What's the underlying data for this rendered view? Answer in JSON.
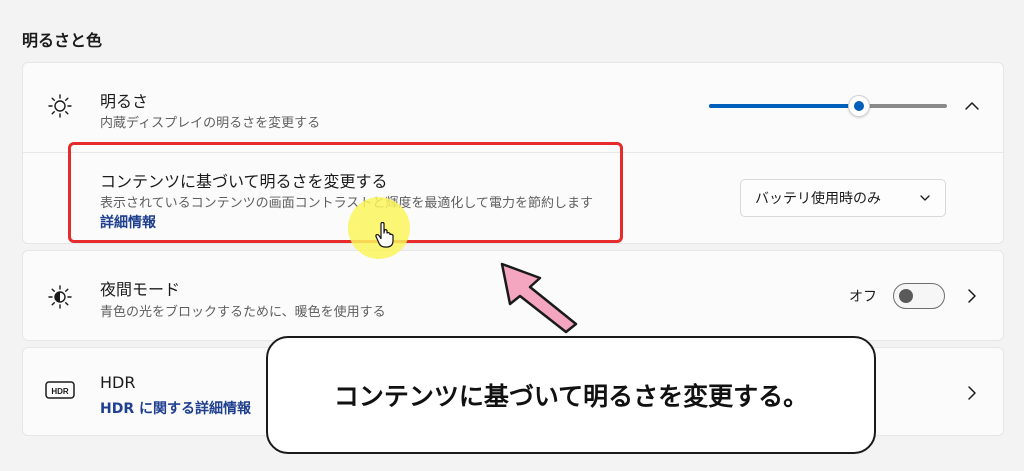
{
  "section": {
    "title": "明るさと色"
  },
  "brightness": {
    "title": "明るさ",
    "description": "内蔵ディスプレイの明るさを変更する",
    "slider_value": 0.63,
    "icon": "sun-icon"
  },
  "content_adaptive": {
    "title": "コンテンツに基づいて明るさを変更する",
    "description": "表示されているコンテンツの画面コントラストと輝度を最適化して電力を節約します",
    "link": "詳細情報",
    "dropdown_value": "バッテリ使用時のみ"
  },
  "night_light": {
    "title": "夜間モード",
    "description": "青色の光をブロックするために、暖色を使用する",
    "toggle_label": "オフ",
    "toggle_on": false,
    "icon": "night-light-icon"
  },
  "hdr": {
    "title": "HDR",
    "link": "HDR に関する詳細情報",
    "icon": "hdr-icon"
  },
  "annotation": {
    "caption": "コンテンツに基づいて明るさを変更する。"
  },
  "colors": {
    "accent": "#005fb8",
    "highlight": "#e52b2b",
    "arrow": "#f4a6c0",
    "cursor_glow": "#faf55a"
  }
}
